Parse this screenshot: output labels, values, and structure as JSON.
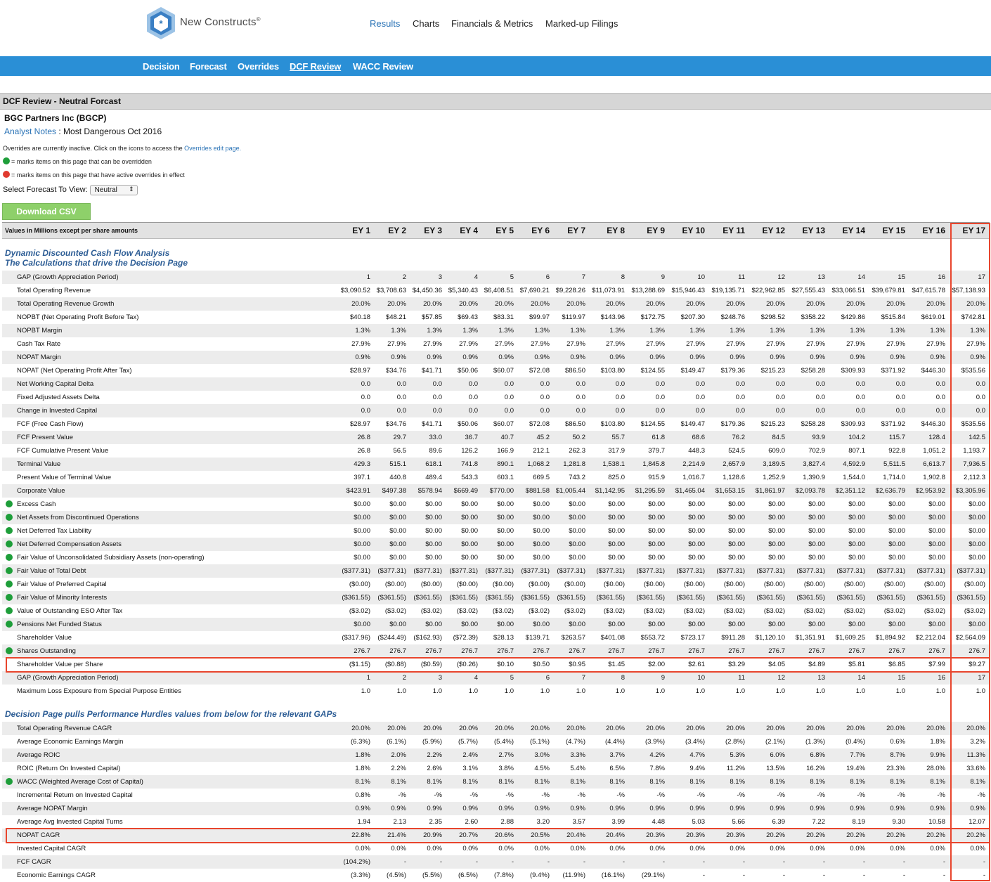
{
  "brand": {
    "name": "New Constructs",
    "reg": "®"
  },
  "topnav": [
    "Results",
    "Charts",
    "Financials & Metrics",
    "Marked-up Filings"
  ],
  "subnav": [
    "Decision",
    "Forecast",
    "Overrides",
    "DCF Review",
    "WACC Review"
  ],
  "section_title": "DCF Review - Neutral Forcast",
  "company": "BGC Partners Inc (BGCP)",
  "analyst_notes_link": "Analyst Notes",
  "analyst_notes_text": " : Most Dangerous Oct 2016",
  "overrides_text": "Overrides are currently inactive. Click on the icons to access the ",
  "overrides_link": "Overrides edit page.",
  "legend_green": "= marks items on this page that can be overridden",
  "legend_red": "= marks items on this page that have active overrides in effect",
  "forecast_label": "Select Forecast To View:",
  "forecast_value": "Neutral",
  "download_label": "Download CSV",
  "table_caption": "Values in Millions except per share amounts",
  "years": [
    "EY 1",
    "EY 2",
    "EY 3",
    "EY 4",
    "EY 5",
    "EY 6",
    "EY 7",
    "EY 8",
    "EY 9",
    "EY 10",
    "EY 11",
    "EY 12",
    "EY 13",
    "EY 14",
    "EY 15",
    "EY 16",
    "EY 17"
  ],
  "section1": [
    "Dynamic Discounted Cash Flow Analysis",
    "The Calculations that drive the Decision Page"
  ],
  "rows1": [
    {
      "label": "GAP (Growth Appreciation Period)",
      "g": false,
      "v": [
        "1",
        "2",
        "3",
        "4",
        "5",
        "6",
        "7",
        "8",
        "9",
        "10",
        "11",
        "12",
        "13",
        "14",
        "15",
        "16",
        "17"
      ]
    },
    {
      "label": "Total Operating Revenue",
      "g": false,
      "v": [
        "$3,090.52",
        "$3,708.63",
        "$4,450.36",
        "$5,340.43",
        "$6,408.51",
        "$7,690.21",
        "$9,228.26",
        "$11,073.91",
        "$13,288.69",
        "$15,946.43",
        "$19,135.71",
        "$22,962.85",
        "$27,555.43",
        "$33,066.51",
        "$39,679.81",
        "$47,615.78",
        "$57,138.93"
      ]
    },
    {
      "label": "Total Operating Revenue Growth",
      "g": false,
      "v": [
        "20.0%",
        "20.0%",
        "20.0%",
        "20.0%",
        "20.0%",
        "20.0%",
        "20.0%",
        "20.0%",
        "20.0%",
        "20.0%",
        "20.0%",
        "20.0%",
        "20.0%",
        "20.0%",
        "20.0%",
        "20.0%",
        "20.0%"
      ]
    },
    {
      "label": "NOPBT (Net Operating Profit Before Tax)",
      "g": false,
      "v": [
        "$40.18",
        "$48.21",
        "$57.85",
        "$69.43",
        "$83.31",
        "$99.97",
        "$119.97",
        "$143.96",
        "$172.75",
        "$207.30",
        "$248.76",
        "$298.52",
        "$358.22",
        "$429.86",
        "$515.84",
        "$619.01",
        "$742.81"
      ]
    },
    {
      "label": "NOPBT Margin",
      "g": false,
      "v": [
        "1.3%",
        "1.3%",
        "1.3%",
        "1.3%",
        "1.3%",
        "1.3%",
        "1.3%",
        "1.3%",
        "1.3%",
        "1.3%",
        "1.3%",
        "1.3%",
        "1.3%",
        "1.3%",
        "1.3%",
        "1.3%",
        "1.3%"
      ]
    },
    {
      "label": "Cash Tax Rate",
      "g": false,
      "v": [
        "27.9%",
        "27.9%",
        "27.9%",
        "27.9%",
        "27.9%",
        "27.9%",
        "27.9%",
        "27.9%",
        "27.9%",
        "27.9%",
        "27.9%",
        "27.9%",
        "27.9%",
        "27.9%",
        "27.9%",
        "27.9%",
        "27.9%"
      ]
    },
    {
      "label": "NOPAT Margin",
      "g": false,
      "v": [
        "0.9%",
        "0.9%",
        "0.9%",
        "0.9%",
        "0.9%",
        "0.9%",
        "0.9%",
        "0.9%",
        "0.9%",
        "0.9%",
        "0.9%",
        "0.9%",
        "0.9%",
        "0.9%",
        "0.9%",
        "0.9%",
        "0.9%"
      ]
    },
    {
      "label": "NOPAT (Net Operating Profit After Tax)",
      "g": false,
      "v": [
        "$28.97",
        "$34.76",
        "$41.71",
        "$50.06",
        "$60.07",
        "$72.08",
        "$86.50",
        "$103.80",
        "$124.55",
        "$149.47",
        "$179.36",
        "$215.23",
        "$258.28",
        "$309.93",
        "$371.92",
        "$446.30",
        "$535.56"
      ]
    },
    {
      "label": "Net Working Capital Delta",
      "g": false,
      "v": [
        "0.0",
        "0.0",
        "0.0",
        "0.0",
        "0.0",
        "0.0",
        "0.0",
        "0.0",
        "0.0",
        "0.0",
        "0.0",
        "0.0",
        "0.0",
        "0.0",
        "0.0",
        "0.0",
        "0.0"
      ]
    },
    {
      "label": "Fixed Adjusted Assets Delta",
      "g": false,
      "v": [
        "0.0",
        "0.0",
        "0.0",
        "0.0",
        "0.0",
        "0.0",
        "0.0",
        "0.0",
        "0.0",
        "0.0",
        "0.0",
        "0.0",
        "0.0",
        "0.0",
        "0.0",
        "0.0",
        "0.0"
      ]
    },
    {
      "label": "Change in Invested Capital",
      "g": false,
      "v": [
        "0.0",
        "0.0",
        "0.0",
        "0.0",
        "0.0",
        "0.0",
        "0.0",
        "0.0",
        "0.0",
        "0.0",
        "0.0",
        "0.0",
        "0.0",
        "0.0",
        "0.0",
        "0.0",
        "0.0"
      ]
    },
    {
      "label": "FCF (Free Cash Flow)",
      "g": false,
      "v": [
        "$28.97",
        "$34.76",
        "$41.71",
        "$50.06",
        "$60.07",
        "$72.08",
        "$86.50",
        "$103.80",
        "$124.55",
        "$149.47",
        "$179.36",
        "$215.23",
        "$258.28",
        "$309.93",
        "$371.92",
        "$446.30",
        "$535.56"
      ]
    },
    {
      "label": "FCF Present Value",
      "g": false,
      "v": [
        "26.8",
        "29.7",
        "33.0",
        "36.7",
        "40.7",
        "45.2",
        "50.2",
        "55.7",
        "61.8",
        "68.6",
        "76.2",
        "84.5",
        "93.9",
        "104.2",
        "115.7",
        "128.4",
        "142.5"
      ]
    },
    {
      "label": "FCF Cumulative Present Value",
      "g": false,
      "v": [
        "26.8",
        "56.5",
        "89.6",
        "126.2",
        "166.9",
        "212.1",
        "262.3",
        "317.9",
        "379.7",
        "448.3",
        "524.5",
        "609.0",
        "702.9",
        "807.1",
        "922.8",
        "1,051.2",
        "1,193.7"
      ]
    },
    {
      "label": "Terminal Value",
      "g": false,
      "v": [
        "429.3",
        "515.1",
        "618.1",
        "741.8",
        "890.1",
        "1,068.2",
        "1,281.8",
        "1,538.1",
        "1,845.8",
        "2,214.9",
        "2,657.9",
        "3,189.5",
        "3,827.4",
        "4,592.9",
        "5,511.5",
        "6,613.7",
        "7,936.5"
      ]
    },
    {
      "label": "Present Value of Terminal Value",
      "g": false,
      "v": [
        "397.1",
        "440.8",
        "489.4",
        "543.3",
        "603.1",
        "669.5",
        "743.2",
        "825.0",
        "915.9",
        "1,016.7",
        "1,128.6",
        "1,252.9",
        "1,390.9",
        "1,544.0",
        "1,714.0",
        "1,902.8",
        "2,112.3"
      ]
    },
    {
      "label": "Corporate Value",
      "g": false,
      "v": [
        "$423.91",
        "$497.38",
        "$578.94",
        "$669.49",
        "$770.00",
        "$881.58",
        "$1,005.44",
        "$1,142.95",
        "$1,295.59",
        "$1,465.04",
        "$1,653.15",
        "$1,861.97",
        "$2,093.78",
        "$2,351.12",
        "$2,636.79",
        "$2,953.92",
        "$3,305.96"
      ]
    },
    {
      "label": "Excess Cash",
      "g": true,
      "v": [
        "$0.00",
        "$0.00",
        "$0.00",
        "$0.00",
        "$0.00",
        "$0.00",
        "$0.00",
        "$0.00",
        "$0.00",
        "$0.00",
        "$0.00",
        "$0.00",
        "$0.00",
        "$0.00",
        "$0.00",
        "$0.00",
        "$0.00"
      ]
    },
    {
      "label": "Net Assets from Discontinued Operations",
      "g": true,
      "v": [
        "$0.00",
        "$0.00",
        "$0.00",
        "$0.00",
        "$0.00",
        "$0.00",
        "$0.00",
        "$0.00",
        "$0.00",
        "$0.00",
        "$0.00",
        "$0.00",
        "$0.00",
        "$0.00",
        "$0.00",
        "$0.00",
        "$0.00"
      ]
    },
    {
      "label": "Net Deferred Tax Liability",
      "g": true,
      "v": [
        "$0.00",
        "$0.00",
        "$0.00",
        "$0.00",
        "$0.00",
        "$0.00",
        "$0.00",
        "$0.00",
        "$0.00",
        "$0.00",
        "$0.00",
        "$0.00",
        "$0.00",
        "$0.00",
        "$0.00",
        "$0.00",
        "$0.00"
      ]
    },
    {
      "label": "Net Deferred Compensation Assets",
      "g": true,
      "v": [
        "$0.00",
        "$0.00",
        "$0.00",
        "$0.00",
        "$0.00",
        "$0.00",
        "$0.00",
        "$0.00",
        "$0.00",
        "$0.00",
        "$0.00",
        "$0.00",
        "$0.00",
        "$0.00",
        "$0.00",
        "$0.00",
        "$0.00"
      ]
    },
    {
      "label": "Fair Value of Unconsolidated Subsidiary Assets (non-operating)",
      "g": true,
      "v": [
        "$0.00",
        "$0.00",
        "$0.00",
        "$0.00",
        "$0.00",
        "$0.00",
        "$0.00",
        "$0.00",
        "$0.00",
        "$0.00",
        "$0.00",
        "$0.00",
        "$0.00",
        "$0.00",
        "$0.00",
        "$0.00",
        "$0.00"
      ]
    },
    {
      "label": "Fair Value of Total Debt",
      "g": true,
      "v": [
        "($377.31)",
        "($377.31)",
        "($377.31)",
        "($377.31)",
        "($377.31)",
        "($377.31)",
        "($377.31)",
        "($377.31)",
        "($377.31)",
        "($377.31)",
        "($377.31)",
        "($377.31)",
        "($377.31)",
        "($377.31)",
        "($377.31)",
        "($377.31)",
        "($377.31)"
      ]
    },
    {
      "label": "Fair Value of Preferred Capital",
      "g": true,
      "v": [
        "($0.00)",
        "($0.00)",
        "($0.00)",
        "($0.00)",
        "($0.00)",
        "($0.00)",
        "($0.00)",
        "($0.00)",
        "($0.00)",
        "($0.00)",
        "($0.00)",
        "($0.00)",
        "($0.00)",
        "($0.00)",
        "($0.00)",
        "($0.00)",
        "($0.00)"
      ]
    },
    {
      "label": "Fair Value of Minority Interests",
      "g": true,
      "v": [
        "($361.55)",
        "($361.55)",
        "($361.55)",
        "($361.55)",
        "($361.55)",
        "($361.55)",
        "($361.55)",
        "($361.55)",
        "($361.55)",
        "($361.55)",
        "($361.55)",
        "($361.55)",
        "($361.55)",
        "($361.55)",
        "($361.55)",
        "($361.55)",
        "($361.55)"
      ]
    },
    {
      "label": "Value of Outstanding ESO After Tax",
      "g": true,
      "v": [
        "($3.02)",
        "($3.02)",
        "($3.02)",
        "($3.02)",
        "($3.02)",
        "($3.02)",
        "($3.02)",
        "($3.02)",
        "($3.02)",
        "($3.02)",
        "($3.02)",
        "($3.02)",
        "($3.02)",
        "($3.02)",
        "($3.02)",
        "($3.02)",
        "($3.02)"
      ]
    },
    {
      "label": "Pensions Net Funded Status",
      "g": true,
      "v": [
        "$0.00",
        "$0.00",
        "$0.00",
        "$0.00",
        "$0.00",
        "$0.00",
        "$0.00",
        "$0.00",
        "$0.00",
        "$0.00",
        "$0.00",
        "$0.00",
        "$0.00",
        "$0.00",
        "$0.00",
        "$0.00",
        "$0.00"
      ]
    },
    {
      "label": "Shareholder Value",
      "g": false,
      "v": [
        "($317.96)",
        "($244.49)",
        "($162.93)",
        "($72.39)",
        "$28.13",
        "$139.71",
        "$263.57",
        "$401.08",
        "$553.72",
        "$723.17",
        "$911.28",
        "$1,120.10",
        "$1,351.91",
        "$1,609.25",
        "$1,894.92",
        "$2,212.04",
        "$2,564.09"
      ]
    },
    {
      "label": "Shares Outstanding",
      "g": true,
      "v": [
        "276.7",
        "276.7",
        "276.7",
        "276.7",
        "276.7",
        "276.7",
        "276.7",
        "276.7",
        "276.7",
        "276.7",
        "276.7",
        "276.7",
        "276.7",
        "276.7",
        "276.7",
        "276.7",
        "276.7"
      ]
    },
    {
      "label": "Shareholder Value per Share",
      "g": false,
      "v": [
        "($1.15)",
        "($0.88)",
        "($0.59)",
        "($0.26)",
        "$0.10",
        "$0.50",
        "$0.95",
        "$1.45",
        "$2.00",
        "$2.61",
        "$3.29",
        "$4.05",
        "$4.89",
        "$5.81",
        "$6.85",
        "$7.99",
        "$9.27"
      ]
    },
    {
      "label": "GAP (Growth Appreciation Period)",
      "g": false,
      "v": [
        "1",
        "2",
        "3",
        "4",
        "5",
        "6",
        "7",
        "8",
        "9",
        "10",
        "11",
        "12",
        "13",
        "14",
        "15",
        "16",
        "17"
      ]
    },
    {
      "label": "Maximum Loss Exposure from Special Purpose Entities",
      "g": false,
      "v": [
        "1.0",
        "1.0",
        "1.0",
        "1.0",
        "1.0",
        "1.0",
        "1.0",
        "1.0",
        "1.0",
        "1.0",
        "1.0",
        "1.0",
        "1.0",
        "1.0",
        "1.0",
        "1.0",
        "1.0"
      ]
    }
  ],
  "section2": "Decision Page pulls Performance Hurdles values from below for the relevant GAPs",
  "rows2": [
    {
      "label": "Total Operating Revenue CAGR",
      "g": false,
      "v": [
        "20.0%",
        "20.0%",
        "20.0%",
        "20.0%",
        "20.0%",
        "20.0%",
        "20.0%",
        "20.0%",
        "20.0%",
        "20.0%",
        "20.0%",
        "20.0%",
        "20.0%",
        "20.0%",
        "20.0%",
        "20.0%",
        "20.0%"
      ]
    },
    {
      "label": "Average Economic Earnings Margin",
      "g": false,
      "v": [
        "(6.3%)",
        "(6.1%)",
        "(5.9%)",
        "(5.7%)",
        "(5.4%)",
        "(5.1%)",
        "(4.7%)",
        "(4.4%)",
        "(3.9%)",
        "(3.4%)",
        "(2.8%)",
        "(2.1%)",
        "(1.3%)",
        "(0.4%)",
        "0.6%",
        "1.8%",
        "3.2%"
      ]
    },
    {
      "label": "Average ROIC",
      "g": false,
      "v": [
        "1.8%",
        "2.0%",
        "2.2%",
        "2.4%",
        "2.7%",
        "3.0%",
        "3.3%",
        "3.7%",
        "4.2%",
        "4.7%",
        "5.3%",
        "6.0%",
        "6.8%",
        "7.7%",
        "8.7%",
        "9.9%",
        "11.3%"
      ]
    },
    {
      "label": "ROIC (Return On Invested Capital)",
      "g": false,
      "v": [
        "1.8%",
        "2.2%",
        "2.6%",
        "3.1%",
        "3.8%",
        "4.5%",
        "5.4%",
        "6.5%",
        "7.8%",
        "9.4%",
        "11.2%",
        "13.5%",
        "16.2%",
        "19.4%",
        "23.3%",
        "28.0%",
        "33.6%"
      ]
    },
    {
      "label": "WACC (Weighted Average Cost of Capital)",
      "g": true,
      "v": [
        "8.1%",
        "8.1%",
        "8.1%",
        "8.1%",
        "8.1%",
        "8.1%",
        "8.1%",
        "8.1%",
        "8.1%",
        "8.1%",
        "8.1%",
        "8.1%",
        "8.1%",
        "8.1%",
        "8.1%",
        "8.1%",
        "8.1%"
      ]
    },
    {
      "label": "Incremental Return on Invested Capital",
      "g": false,
      "v": [
        "0.8%",
        "-%",
        "-%",
        "-%",
        "-%",
        "-%",
        "-%",
        "-%",
        "-%",
        "-%",
        "-%",
        "-%",
        "-%",
        "-%",
        "-%",
        "-%",
        "-%"
      ]
    },
    {
      "label": "Average NOPAT Margin",
      "g": false,
      "v": [
        "0.9%",
        "0.9%",
        "0.9%",
        "0.9%",
        "0.9%",
        "0.9%",
        "0.9%",
        "0.9%",
        "0.9%",
        "0.9%",
        "0.9%",
        "0.9%",
        "0.9%",
        "0.9%",
        "0.9%",
        "0.9%",
        "0.9%"
      ]
    },
    {
      "label": "Average Avg Invested Capital Turns",
      "g": false,
      "v": [
        "1.94",
        "2.13",
        "2.35",
        "2.60",
        "2.88",
        "3.20",
        "3.57",
        "3.99",
        "4.48",
        "5.03",
        "5.66",
        "6.39",
        "7.22",
        "8.19",
        "9.30",
        "10.58",
        "12.07"
      ]
    },
    {
      "label": "NOPAT CAGR",
      "g": false,
      "v": [
        "22.8%",
        "21.4%",
        "20.9%",
        "20.7%",
        "20.6%",
        "20.5%",
        "20.4%",
        "20.4%",
        "20.3%",
        "20.3%",
        "20.3%",
        "20.2%",
        "20.2%",
        "20.2%",
        "20.2%",
        "20.2%",
        "20.2%"
      ]
    },
    {
      "label": "Invested Capital CAGR",
      "g": false,
      "v": [
        "0.0%",
        "0.0%",
        "0.0%",
        "0.0%",
        "0.0%",
        "0.0%",
        "0.0%",
        "0.0%",
        "0.0%",
        "0.0%",
        "0.0%",
        "0.0%",
        "0.0%",
        "0.0%",
        "0.0%",
        "0.0%",
        "0.0%"
      ]
    },
    {
      "label": "FCF CAGR",
      "g": false,
      "v": [
        "(104.2%)",
        "-",
        "-",
        "-",
        "-",
        "-",
        "-",
        "-",
        "-",
        "-",
        "-",
        "-",
        "-",
        "-",
        "-",
        "-",
        "-"
      ]
    },
    {
      "label": "Economic Earnings CAGR",
      "g": false,
      "v": [
        "(3.3%)",
        "(4.5%)",
        "(5.5%)",
        "(6.5%)",
        "(7.8%)",
        "(9.4%)",
        "(11.9%)",
        "(16.1%)",
        "(29.1%)",
        "-",
        "-",
        "-",
        "-",
        "-",
        "-",
        "-",
        "-"
      ]
    }
  ]
}
